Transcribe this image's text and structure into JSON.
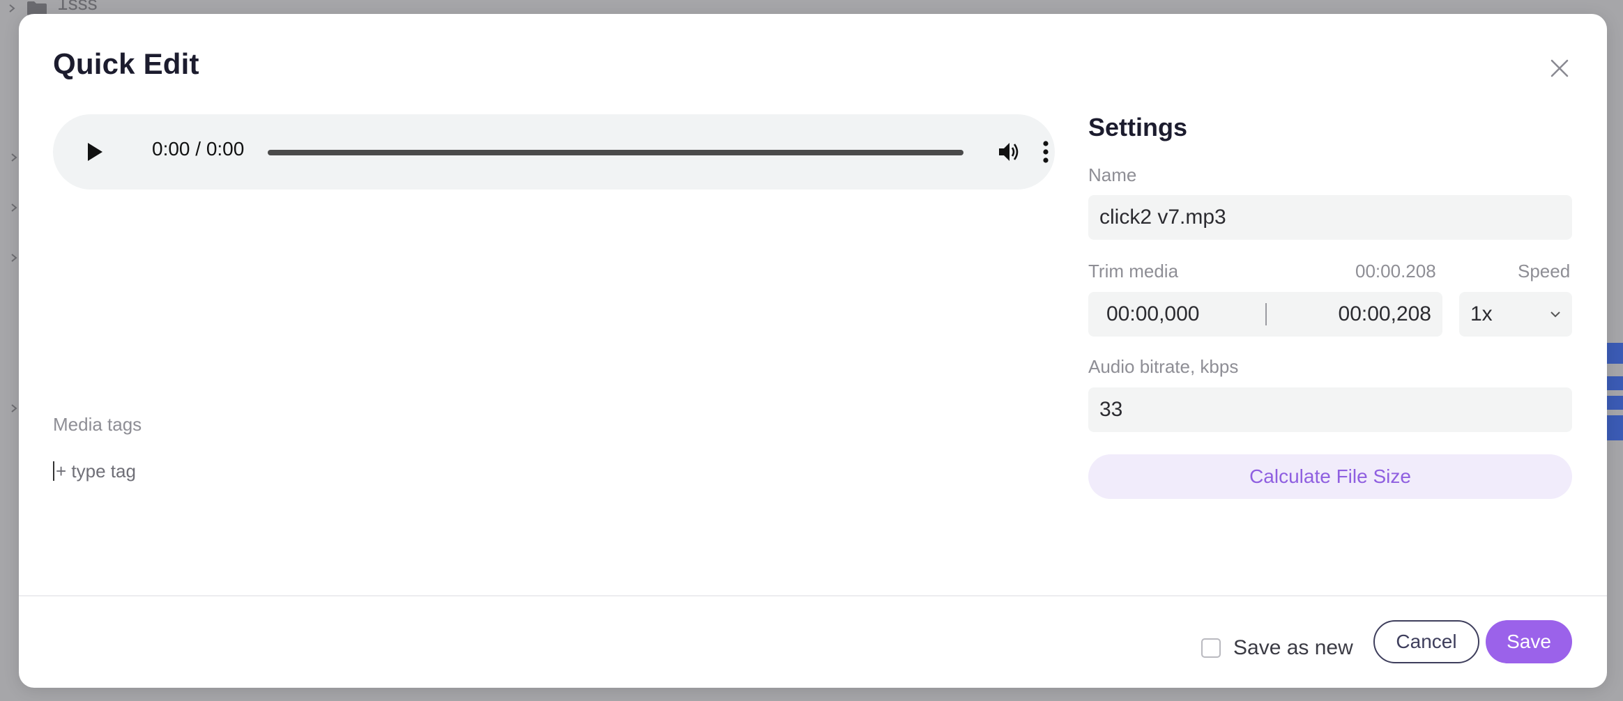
{
  "background": {
    "folder_name": "1sss"
  },
  "modal": {
    "title": "Quick Edit",
    "close_icon": "close-icon"
  },
  "player": {
    "time": "0:00 / 0:00",
    "progress": 0,
    "icons": [
      "play-icon",
      "volume-icon",
      "more-vert-icon"
    ]
  },
  "media_tags": {
    "label": "Media tags",
    "placeholder": "+ type tag"
  },
  "settings": {
    "title": "Settings",
    "name_label": "Name",
    "name_value": "click2 v7.mp3",
    "trim_label": "Trim media",
    "trim_duration": "00:00.208",
    "trim_start": "00:00,000",
    "trim_end": "00:00,208",
    "speed_label": "Speed",
    "speed_value": "1x",
    "bitrate_label": "Audio bitrate, kbps",
    "bitrate_value": "33",
    "calculate_label": "Calculate File Size"
  },
  "footer": {
    "save_as_new_label": "Save as new",
    "save_as_new_checked": false,
    "cancel_label": "Cancel",
    "save_label": "Save"
  },
  "colors": {
    "accent": "#9b62ea",
    "accent_light": "#f1ecfb",
    "title_text": "#1c1c2e",
    "label_text": "#8e8e95"
  }
}
